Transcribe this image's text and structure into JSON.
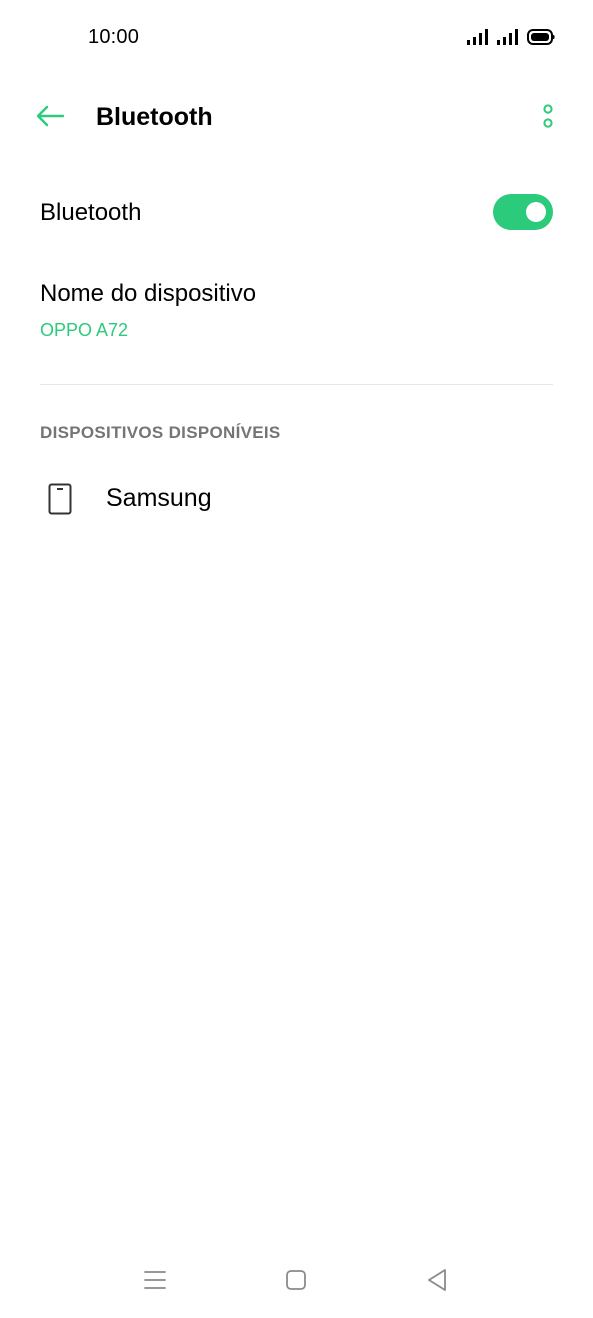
{
  "status_bar": {
    "time": "10:00",
    "icons": [
      "signal-icon",
      "signal-icon",
      "battery-icon"
    ]
  },
  "app_bar": {
    "title": "Bluetooth",
    "back_icon": "arrow-left-icon",
    "more_icon": "more-vertical-icon"
  },
  "bluetooth_toggle": {
    "label": "Bluetooth",
    "enabled": true
  },
  "device_name": {
    "label": "Nome do dispositivo",
    "value": "OPPO A72"
  },
  "available_devices": {
    "header": "DISPOSITIVOS DISPONÍVEIS",
    "items": [
      {
        "name": "Samsung",
        "icon": "phone-icon"
      }
    ]
  },
  "nav_bar": {
    "icons": [
      "menu-icon",
      "home-icon",
      "back-triangle-icon"
    ]
  },
  "colors": {
    "accent": "#2bcb7b",
    "text_primary": "#000000",
    "text_secondary": "#757575",
    "divider": "#e6e6e6",
    "nav_icon": "#8a8a8a"
  }
}
